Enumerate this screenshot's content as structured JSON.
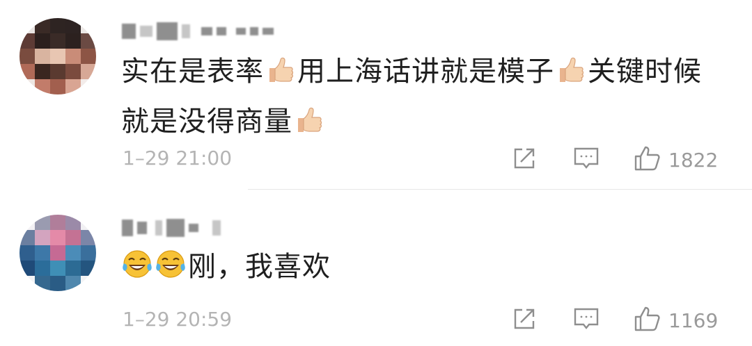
{
  "comments": [
    {
      "text_parts": [
        "实在是表率",
        "用上海话讲就是模子",
        "关键时候就是没得商量"
      ],
      "emoji_after_parts": "thumbs-up-icon",
      "timestamp": "1–29 21:00",
      "likes": "1822"
    },
    {
      "emoji_prefix": [
        "tears-of-joy-icon",
        "tears-of-joy-icon"
      ],
      "text": "刚，我喜欢",
      "timestamp": "1–29 20:59",
      "likes": "1169"
    }
  ],
  "colors": {
    "text": "#1f1f1f",
    "meta": "#b4b4b4",
    "icon": "#8e8e8e",
    "divider": "#e6e6e6"
  }
}
